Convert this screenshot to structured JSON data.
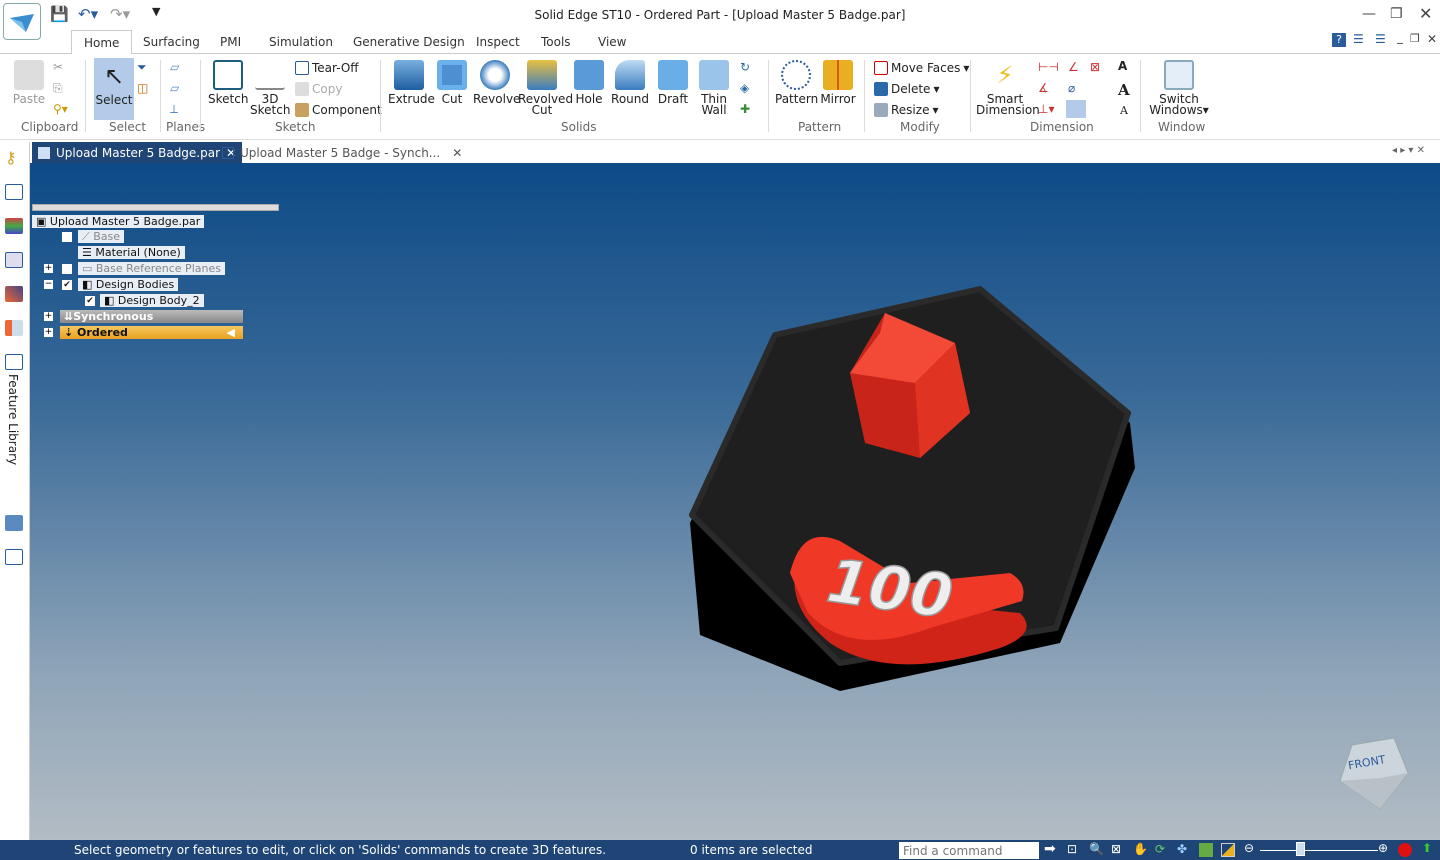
{
  "window": {
    "title": "Solid Edge ST10 - Ordered Part - [Upload Master 5 Badge.par]"
  },
  "tabs": [
    "Home",
    "Surfacing",
    "PMI",
    "Simulation",
    "Generative Design",
    "Inspect",
    "Tools",
    "View"
  ],
  "ribbon": {
    "clipboard": {
      "paste": "Paste",
      "group": "Clipboard"
    },
    "select": {
      "select": "Select",
      "group": "Select"
    },
    "planes": {
      "group": "Planes"
    },
    "sketch": {
      "sketch": "Sketch",
      "sketch3d_1": "3D",
      "sketch3d_2": "Sketch",
      "tearoff": "Tear-Off",
      "copy": "Copy",
      "component": "Component",
      "group": "Sketch"
    },
    "solids": {
      "extrude": "Extrude",
      "cut": "Cut",
      "revolve": "Revolve",
      "revolved_cut_1": "Revolved",
      "revolved_cut_2": "Cut",
      "hole": "Hole",
      "round": "Round",
      "draft": "Draft",
      "thin_wall_1": "Thin",
      "thin_wall_2": "Wall",
      "group": "Solids"
    },
    "pattern": {
      "pattern": "Pattern",
      "mirror": "Mirror",
      "group": "Pattern"
    },
    "modify": {
      "move_faces": "Move Faces",
      "delete": "Delete",
      "resize": "Resize",
      "group": "Modify"
    },
    "dimension": {
      "smart_1": "Smart",
      "smart_2": "Dimension",
      "group": "Dimension"
    },
    "window": {
      "switch_1": "Switch",
      "switch_2": "Windows",
      "group": "Window"
    }
  },
  "doc_tabs": [
    "Upload Master 5 Badge.par",
    "Upload Master 5 Badge - Synch..."
  ],
  "left_panel": {
    "feature_library": "Feature Library"
  },
  "tree": {
    "root": "Upload Master 5 Badge.par",
    "base": "Base",
    "material": "Material (None)",
    "base_planes": "Base Reference Planes",
    "design_bodies": "Design Bodies",
    "design_body": "Design Body_2",
    "synchronous": "Synchronous",
    "ordered": "Ordered"
  },
  "model": {
    "badge_text": "100"
  },
  "view_cube": {
    "label": "FRONT"
  },
  "status": {
    "message": "Select geometry or features to edit, or click on 'Solids' commands to create 3D features.",
    "selection": "0 items are selected",
    "find_placeholder": "Find a command"
  }
}
